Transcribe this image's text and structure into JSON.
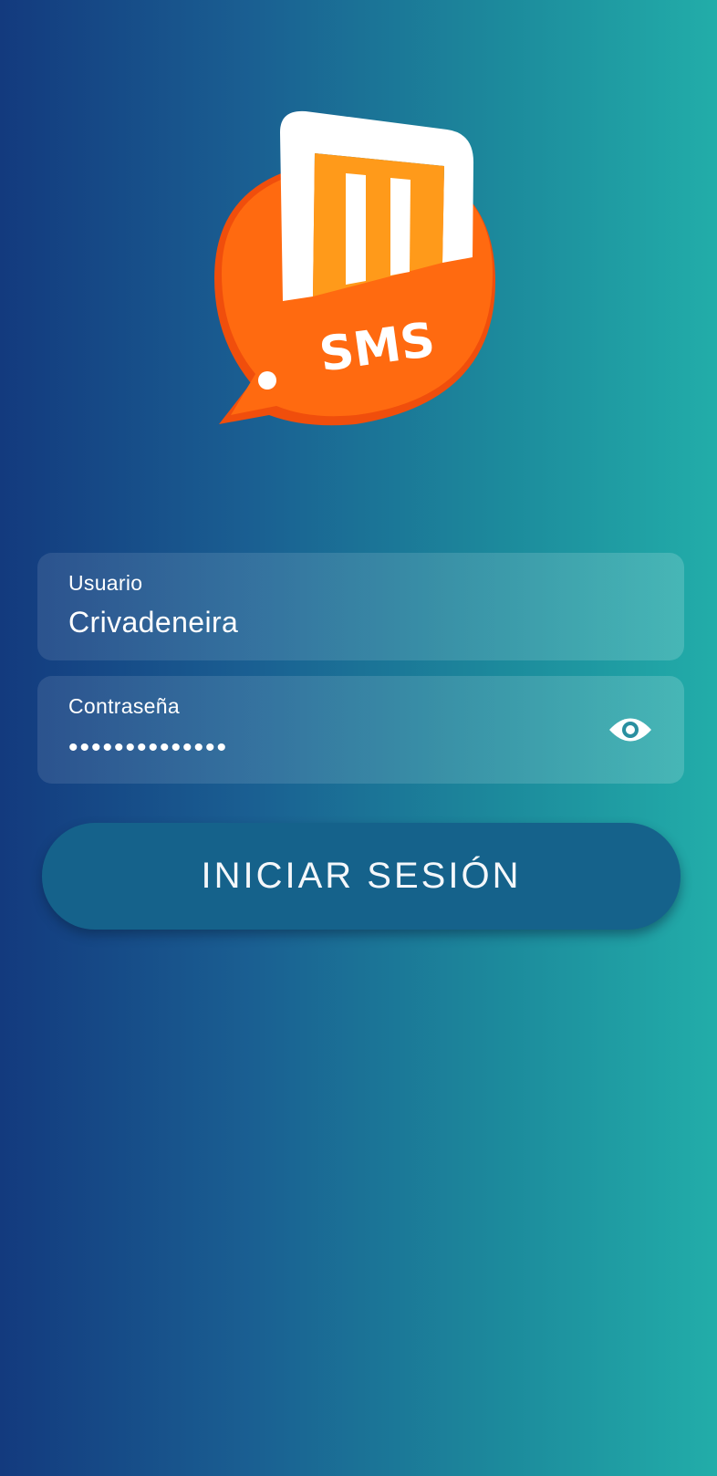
{
  "logo": {
    "text": "SMS",
    "colors": {
      "bubble": "#ff6a10",
      "bubble_shadow": "#f04e0c",
      "inner": "#ff9a1a",
      "frame": "#ffffff"
    }
  },
  "form": {
    "username": {
      "label": "Usuario",
      "value": "Crivadeneira"
    },
    "password": {
      "label": "Contraseña",
      "value": "••••••••••••••",
      "toggle_icon": "eye-icon"
    }
  },
  "login_button": {
    "label": "INICIAR SESIÓN"
  },
  "colors": {
    "gradient_start": "#133a7e",
    "gradient_end": "#22ada9",
    "button": "#15628b"
  }
}
